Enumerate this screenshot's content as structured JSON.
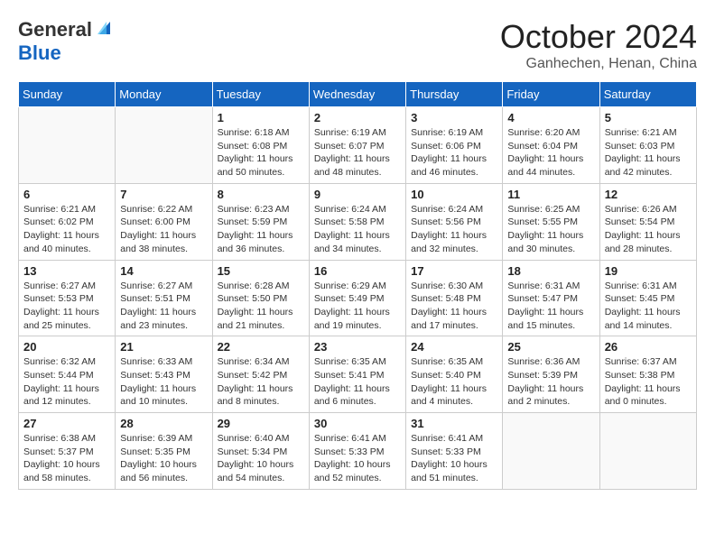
{
  "header": {
    "logo_general": "General",
    "logo_blue": "Blue",
    "month_title": "October 2024",
    "location": "Ganhechen, Henan, China"
  },
  "days_of_week": [
    "Sunday",
    "Monday",
    "Tuesday",
    "Wednesday",
    "Thursday",
    "Friday",
    "Saturday"
  ],
  "weeks": [
    [
      {
        "day": "",
        "info": ""
      },
      {
        "day": "",
        "info": ""
      },
      {
        "day": "1",
        "info": "Sunrise: 6:18 AM\nSunset: 6:08 PM\nDaylight: 11 hours and 50 minutes."
      },
      {
        "day": "2",
        "info": "Sunrise: 6:19 AM\nSunset: 6:07 PM\nDaylight: 11 hours and 48 minutes."
      },
      {
        "day": "3",
        "info": "Sunrise: 6:19 AM\nSunset: 6:06 PM\nDaylight: 11 hours and 46 minutes."
      },
      {
        "day": "4",
        "info": "Sunrise: 6:20 AM\nSunset: 6:04 PM\nDaylight: 11 hours and 44 minutes."
      },
      {
        "day": "5",
        "info": "Sunrise: 6:21 AM\nSunset: 6:03 PM\nDaylight: 11 hours and 42 minutes."
      }
    ],
    [
      {
        "day": "6",
        "info": "Sunrise: 6:21 AM\nSunset: 6:02 PM\nDaylight: 11 hours and 40 minutes."
      },
      {
        "day": "7",
        "info": "Sunrise: 6:22 AM\nSunset: 6:00 PM\nDaylight: 11 hours and 38 minutes."
      },
      {
        "day": "8",
        "info": "Sunrise: 6:23 AM\nSunset: 5:59 PM\nDaylight: 11 hours and 36 minutes."
      },
      {
        "day": "9",
        "info": "Sunrise: 6:24 AM\nSunset: 5:58 PM\nDaylight: 11 hours and 34 minutes."
      },
      {
        "day": "10",
        "info": "Sunrise: 6:24 AM\nSunset: 5:56 PM\nDaylight: 11 hours and 32 minutes."
      },
      {
        "day": "11",
        "info": "Sunrise: 6:25 AM\nSunset: 5:55 PM\nDaylight: 11 hours and 30 minutes."
      },
      {
        "day": "12",
        "info": "Sunrise: 6:26 AM\nSunset: 5:54 PM\nDaylight: 11 hours and 28 minutes."
      }
    ],
    [
      {
        "day": "13",
        "info": "Sunrise: 6:27 AM\nSunset: 5:53 PM\nDaylight: 11 hours and 25 minutes."
      },
      {
        "day": "14",
        "info": "Sunrise: 6:27 AM\nSunset: 5:51 PM\nDaylight: 11 hours and 23 minutes."
      },
      {
        "day": "15",
        "info": "Sunrise: 6:28 AM\nSunset: 5:50 PM\nDaylight: 11 hours and 21 minutes."
      },
      {
        "day": "16",
        "info": "Sunrise: 6:29 AM\nSunset: 5:49 PM\nDaylight: 11 hours and 19 minutes."
      },
      {
        "day": "17",
        "info": "Sunrise: 6:30 AM\nSunset: 5:48 PM\nDaylight: 11 hours and 17 minutes."
      },
      {
        "day": "18",
        "info": "Sunrise: 6:31 AM\nSunset: 5:47 PM\nDaylight: 11 hours and 15 minutes."
      },
      {
        "day": "19",
        "info": "Sunrise: 6:31 AM\nSunset: 5:45 PM\nDaylight: 11 hours and 14 minutes."
      }
    ],
    [
      {
        "day": "20",
        "info": "Sunrise: 6:32 AM\nSunset: 5:44 PM\nDaylight: 11 hours and 12 minutes."
      },
      {
        "day": "21",
        "info": "Sunrise: 6:33 AM\nSunset: 5:43 PM\nDaylight: 11 hours and 10 minutes."
      },
      {
        "day": "22",
        "info": "Sunrise: 6:34 AM\nSunset: 5:42 PM\nDaylight: 11 hours and 8 minutes."
      },
      {
        "day": "23",
        "info": "Sunrise: 6:35 AM\nSunset: 5:41 PM\nDaylight: 11 hours and 6 minutes."
      },
      {
        "day": "24",
        "info": "Sunrise: 6:35 AM\nSunset: 5:40 PM\nDaylight: 11 hours and 4 minutes."
      },
      {
        "day": "25",
        "info": "Sunrise: 6:36 AM\nSunset: 5:39 PM\nDaylight: 11 hours and 2 minutes."
      },
      {
        "day": "26",
        "info": "Sunrise: 6:37 AM\nSunset: 5:38 PM\nDaylight: 11 hours and 0 minutes."
      }
    ],
    [
      {
        "day": "27",
        "info": "Sunrise: 6:38 AM\nSunset: 5:37 PM\nDaylight: 10 hours and 58 minutes."
      },
      {
        "day": "28",
        "info": "Sunrise: 6:39 AM\nSunset: 5:35 PM\nDaylight: 10 hours and 56 minutes."
      },
      {
        "day": "29",
        "info": "Sunrise: 6:40 AM\nSunset: 5:34 PM\nDaylight: 10 hours and 54 minutes."
      },
      {
        "day": "30",
        "info": "Sunrise: 6:41 AM\nSunset: 5:33 PM\nDaylight: 10 hours and 52 minutes."
      },
      {
        "day": "31",
        "info": "Sunrise: 6:41 AM\nSunset: 5:33 PM\nDaylight: 10 hours and 51 minutes."
      },
      {
        "day": "",
        "info": ""
      },
      {
        "day": "",
        "info": ""
      }
    ]
  ]
}
